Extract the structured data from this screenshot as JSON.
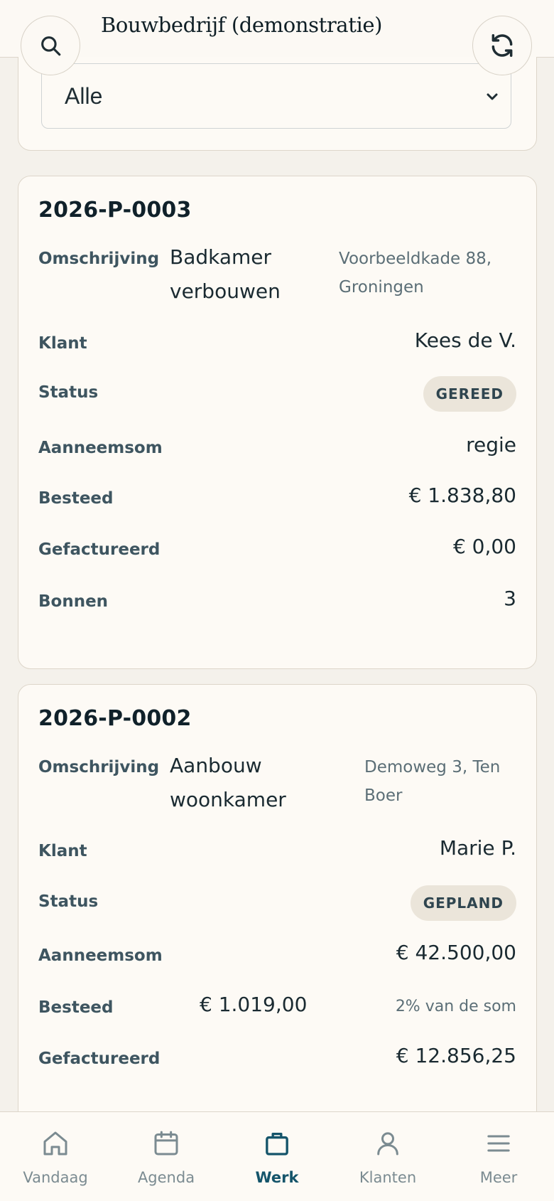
{
  "header": {
    "title": "Bouwbedrijf (demonstratie)"
  },
  "filter": {
    "selected": "Alle"
  },
  "projects": [
    {
      "number": "2026-P-0003",
      "labels": {
        "description": "Omschrijving",
        "client": "Klant",
        "status": "Status",
        "contract": "Aanneemsom",
        "spent": "Besteed",
        "invoiced": "Gefactureerd",
        "receipts": "Bonnen"
      },
      "description_line1": "Badkamer",
      "description_line2": "verbouwen",
      "address_line1": "Voorbeeldkade 88,",
      "address_line2": "Groningen",
      "client": "Kees de V.",
      "status": "GEREED",
      "contract": "regie",
      "spent": "€ 1.838,80",
      "invoiced": "€ 0,00",
      "receipts": "3"
    },
    {
      "number": "2026-P-0002",
      "labels": {
        "description": "Omschrijving",
        "client": "Klant",
        "status": "Status",
        "contract": "Aanneemsom",
        "spent": "Besteed",
        "invoiced": "Gefactureerd"
      },
      "description_line1": "Aanbouw",
      "description_line2": "woonkamer",
      "address_line1": "Demoweg 3, Ten",
      "address_line2": "Boer",
      "client": "Marie P.",
      "status": "GEPLAND",
      "contract": "€ 42.500,00",
      "spent": "€ 1.019,00",
      "spent_hint": "2% van de som",
      "invoiced": "€ 12.856,25"
    }
  ],
  "nav": {
    "items": [
      {
        "label": "Vandaag",
        "icon": "home-icon"
      },
      {
        "label": "Agenda",
        "icon": "calendar-icon"
      },
      {
        "label": "Werk",
        "icon": "briefcase-icon",
        "active": true
      },
      {
        "label": "Klanten",
        "icon": "person-icon"
      },
      {
        "label": "Meer",
        "icon": "menu-icon"
      }
    ]
  },
  "colors": {
    "accent": "#14546a",
    "background": "#f4f1eb",
    "card": "#fdfaf5"
  }
}
